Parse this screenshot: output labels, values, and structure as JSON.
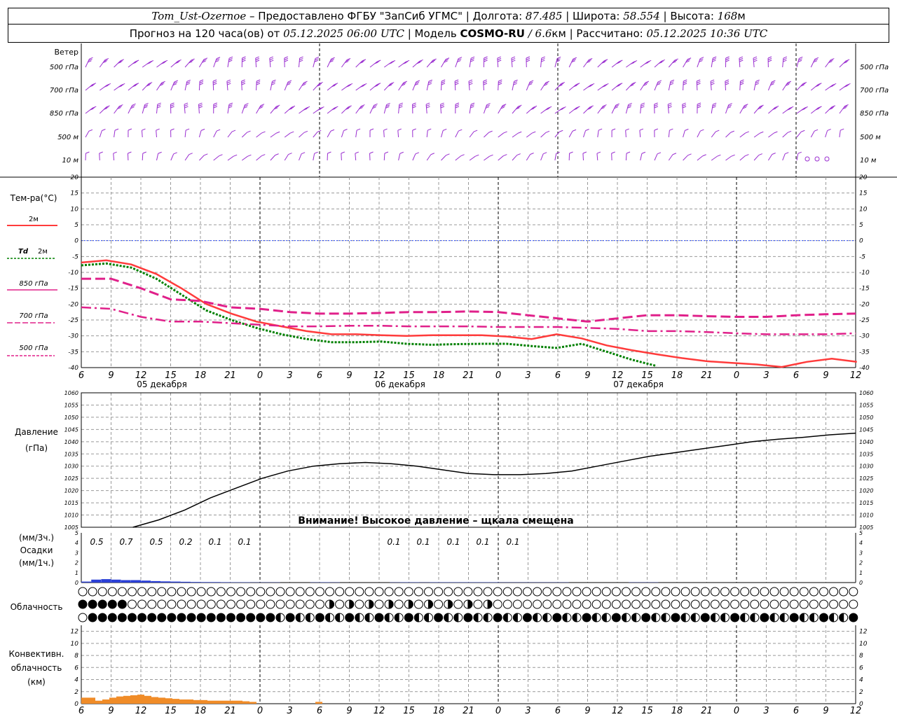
{
  "header": {
    "station": "Tom_Ust-Ozernoe",
    "provided": " – Предоставлено ФГБУ \"ЗапСиб УГМС\" | Долгота: ",
    "lon": "87.485",
    "lat_label": " | Широта: ",
    "lat": "58.554",
    "alt_label": " | Высота: ",
    "alt": "168",
    "alt_unit": "м",
    "forecast_label": "Прогноз на 120 часа(ов) от ",
    "init_time": "05.12.2025 06:00 UTC",
    "model_label": " | Модель ",
    "model": "COSMO-RU",
    "resolution": " / 6.6",
    "res_unit": "км",
    "calc_label": " | Рассчитано: ",
    "calc_time": "05.12.2025 10:36 UTC"
  },
  "labels": {
    "wind": "Ветер",
    "wind_levels": [
      "500 гПа",
      "700 гПа",
      "850 гПа",
      "500 м",
      "10 м"
    ],
    "temp": "Тем-ра(°C)",
    "t2m": "2м",
    "td": "Td",
    "td2m": "2м",
    "t850": "850 гПа",
    "t700": "700 гПа",
    "t500": "500 гПа",
    "pressure1": "Давление",
    "pressure2": "(гПа)",
    "warning": "Внимание! Высокое давление – щкала смещена",
    "precip1": "(мм/3ч.)",
    "precip2": "Осадки",
    "precip3": "(мм/1ч.)",
    "cloud": "Облачность",
    "conv1": "Конвективн.",
    "conv2": "облачность",
    "conv3": "(км)",
    "dates": [
      "05 декабря",
      "06 декабря",
      "07 декабря"
    ]
  },
  "colors": {
    "t2m": "#ff3b3b",
    "td": "#008000",
    "upper": "#e0208a",
    "pressure": "#000000",
    "precip": "#2a3fd6",
    "conv": "#f08c28",
    "wind": "#9a2ed0",
    "zero": "#3050ff"
  },
  "chart_data": [
    {
      "type": "line",
      "title": "Тем-ра(°C)",
      "x_hours": [
        0,
        3,
        6,
        9,
        12,
        15,
        18,
        21,
        24,
        27,
        30,
        33,
        36,
        39,
        42,
        45,
        48,
        51,
        54,
        57,
        60,
        63,
        66,
        69,
        72,
        75,
        78
      ],
      "xticks": [
        "6",
        "9",
        "12",
        "15",
        "18",
        "21",
        "0",
        "3",
        "6",
        "9",
        "12",
        "15",
        "18",
        "21",
        "0",
        "3",
        "6",
        "9",
        "12",
        "15",
        "18",
        "21",
        "0",
        "3",
        "6",
        "9",
        "12"
      ],
      "ylim": [
        -40,
        20
      ],
      "yticks": [
        -40,
        -35,
        -30,
        -25,
        -20,
        -15,
        -10,
        -5,
        0,
        5,
        10,
        15,
        20
      ],
      "series": [
        {
          "name": "2м",
          "values": [
            -6.9,
            -6.2,
            -7.5,
            -10.5,
            -15,
            -20,
            -23,
            -25.5,
            -27,
            -28.5,
            -29.5,
            -29.5,
            -29.8,
            -30,
            -29.8,
            -29.8,
            -29.8,
            -30.2,
            -31,
            -29.5,
            -30.8,
            -33,
            -34.5,
            -35.8,
            -37,
            -38,
            -38.5,
            -39,
            -39.8,
            -38.2,
            -37.2,
            -38.2
          ]
        },
        {
          "name": "Td 2м",
          "values": [
            -7.8,
            -7.2,
            -8.5,
            -12,
            -17,
            -22,
            -25,
            -27.5,
            -29.5,
            -31,
            -32,
            -32,
            -31.8,
            -32.5,
            -32.8,
            -32.6,
            -32.5,
            -32.5,
            -33.2,
            -33.8,
            -32.5,
            -35,
            -37.5,
            -39.5
          ]
        },
        {
          "name": "850 гПа",
          "values": [
            -12,
            -12,
            -15,
            -18.5,
            -19,
            -21,
            -21.5,
            -22.5,
            -23,
            -23,
            -22.8,
            -22.5,
            -22.5,
            -22.3,
            -22.5,
            -23.5,
            -24.5,
            -25.5,
            -24.5,
            -23.5,
            -23.5,
            -23.8,
            -24,
            -24,
            -23.5,
            -23.2,
            -23
          ]
        },
        {
          "name": "700 гПа",
          "values": [
            -21,
            -21.5,
            -24,
            -25.5,
            -25.5,
            -26,
            -26.5,
            -27,
            -27,
            -26.8,
            -26.8,
            -27,
            -27,
            -27,
            -27.2,
            -27.2,
            -27.2,
            -27.5,
            -27.8,
            -28.5,
            -28.5,
            -28.8,
            -29.2,
            -29.5,
            -29.5,
            -29.5,
            -29.2
          ]
        }
      ]
    },
    {
      "type": "line",
      "title": "Давление (гПа)",
      "ylim": [
        1005,
        1060
      ],
      "yticks": [
        1005,
        1010,
        1015,
        1020,
        1025,
        1030,
        1035,
        1040,
        1045,
        1050,
        1055,
        1060
      ],
      "series": [
        {
          "name": "Давление",
          "values": [
            null,
            null,
            1005,
            1008,
            1012,
            1017,
            1021,
            1025,
            1028,
            1030,
            1031,
            1031.5,
            1031,
            1030,
            1028.5,
            1027,
            1026.5,
            1026.5,
            1027,
            1028,
            1030,
            1032,
            1034,
            1035.5,
            1037,
            1038.5,
            1040,
            1041,
            1041.8,
            1042.8,
            1043.5
          ]
        }
      ]
    },
    {
      "type": "bar",
      "title": "Осадки (мм/3ч.) (мм/1ч.)",
      "ylim": [
        0,
        5
      ],
      "yticks": [
        0,
        1,
        2,
        3,
        4,
        5
      ],
      "labels_3h": [
        "0.5",
        "0.7",
        "0.5",
        "0.2",
        "0.1",
        "0.1",
        "0.1",
        "0.1",
        "0.1",
        "0.1",
        "0.1"
      ],
      "values_1h": [
        0.1,
        0.3,
        0.35,
        0.3,
        0.25,
        0.25,
        0.2,
        0.15,
        0.12,
        0.1,
        0.08,
        0.06,
        0.05,
        0.05,
        0.04,
        0.03,
        0.03,
        0.02,
        0.02,
        0.02,
        0,
        0,
        0,
        0.02,
        0.03,
        0.02,
        0,
        0,
        0,
        0,
        0,
        0.02,
        0.03,
        0.03,
        0.02,
        0.03,
        0.03,
        0.03,
        0.03,
        0.03,
        0.03,
        0.03,
        0.02,
        0.02,
        0.02,
        0.02,
        0.02,
        0.02,
        0.02,
        0,
        0,
        0,
        0,
        0,
        0,
        0.02,
        0.02,
        0.02,
        0,
        0,
        0,
        0,
        0,
        0,
        0,
        0
      ]
    },
    {
      "type": "bar",
      "title": "Конвективн. облачность (км)",
      "ylim": [
        0,
        13
      ],
      "yticks": [
        0,
        2,
        4,
        6,
        8,
        10,
        12
      ],
      "values": [
        1,
        1,
        0.5,
        0.7,
        1,
        1.2,
        1.3,
        1.4,
        1.5,
        1.3,
        1.1,
        1,
        0.9,
        0.8,
        0.7,
        0.7,
        0.6,
        0.6,
        0.5,
        0.5,
        0.5,
        0.5,
        0.5,
        0.4,
        0.3,
        0,
        0,
        0,
        0,
        0,
        0,
        0,
        0,
        0,
        0.3
      ]
    }
  ]
}
